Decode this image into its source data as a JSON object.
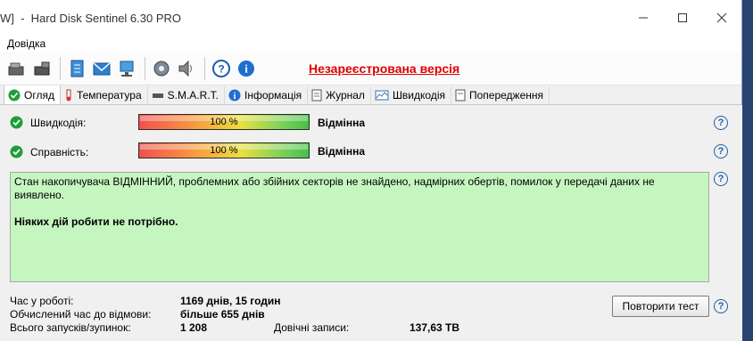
{
  "window": {
    "title": "W]  -  Hard Disk Sentinel 6.30 PRO",
    "controls": {
      "minimize": "—",
      "maximize": "☐",
      "close": "✕"
    }
  },
  "menu": {
    "items": [
      "Довідка"
    ]
  },
  "toolbar": {
    "unregistered_label": "Незареєстрована версія",
    "icons": [
      "disk-refresh-icon",
      "disk-icon",
      "report-icon",
      "mail-icon",
      "network-icon",
      "settings-icon",
      "sound-icon",
      "help-icon",
      "info-icon"
    ]
  },
  "tabs": [
    {
      "label": "Огляд",
      "icon": "check-icon",
      "active": true
    },
    {
      "label": "Температура",
      "icon": "thermometer-icon"
    },
    {
      "label": "S.M.A.R.T.",
      "icon": "smart-icon"
    },
    {
      "label": "Інформація",
      "icon": "info-icon"
    },
    {
      "label": "Журнал",
      "icon": "journal-icon"
    },
    {
      "label": "Швидкодія",
      "icon": "performance-icon"
    },
    {
      "label": "Попередження",
      "icon": "alert-icon"
    }
  ],
  "overview": {
    "performance": {
      "label": "Швидкодія:",
      "value_text": "100 %",
      "value": 100,
      "rating": "Відмінна"
    },
    "health": {
      "label": "Справність:",
      "value_text": "100 %",
      "value": 100,
      "rating": "Відмінна"
    },
    "status_text": "Стан накопичувача ВІДМІННИЙ, проблемних або збійних секторів не знайдено, надмірних обертів, помилок у передачі даних не виявлено.",
    "recommendation": "Ніяких дій робити не потрібно.",
    "help_symbol": "?"
  },
  "stats": {
    "power_on_label": "Час у роботі:",
    "power_on_value": "1169 днів, 15 годин",
    "estimated_label": "Обчислений час до відмови:",
    "estimated_value": "більше 655 днів",
    "starts_label": "Всього запусків/зупинок:",
    "starts_value": "1 208",
    "lifetime_writes_label": "Довічні записи:",
    "lifetime_writes_value": "137,63 TB"
  },
  "buttons": {
    "retest": "Повторити тест"
  }
}
